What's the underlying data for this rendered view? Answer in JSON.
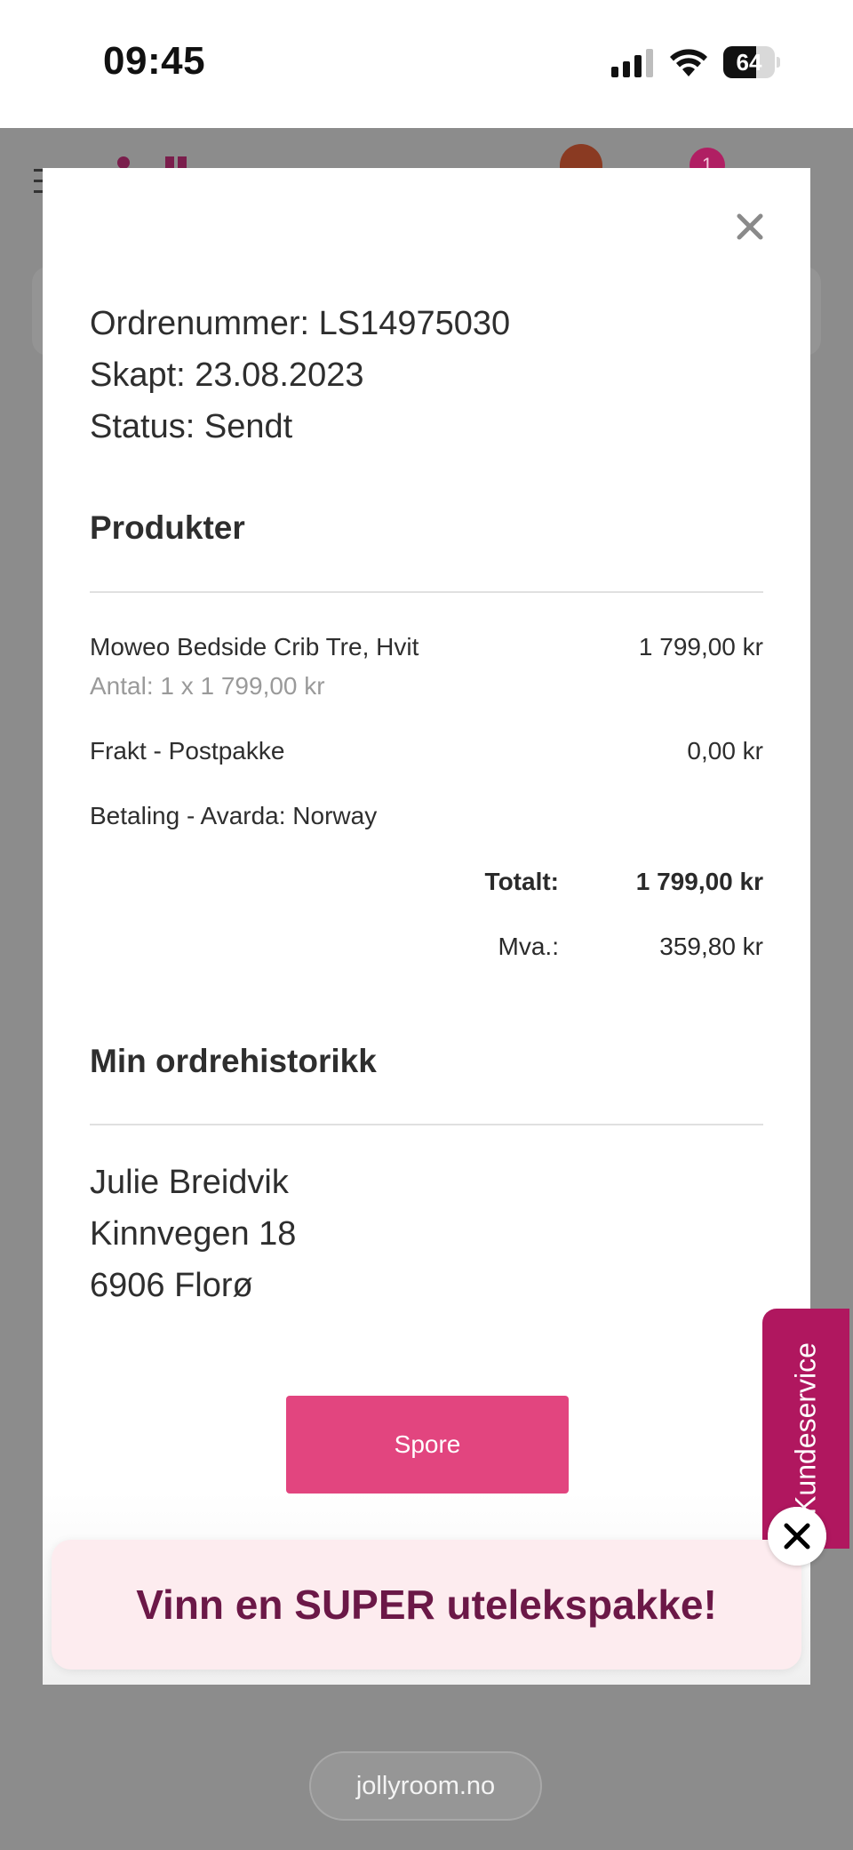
{
  "status_bar": {
    "time": "09:45",
    "battery_level": "64",
    "icons": [
      "signal-icon",
      "wifi-icon",
      "battery-icon"
    ]
  },
  "background": {
    "cart_count": "1",
    "domain": "jollyroom.no"
  },
  "order": {
    "number_line": "Ordrenummer: LS14975030",
    "created_line": "Skapt: 23.08.2023",
    "status_line": "Status: Sendt"
  },
  "products": {
    "title": "Produkter",
    "item": {
      "name": "Moweo Bedside Crib Tre, Hvit",
      "price": "1 799,00 kr",
      "quantity": "Antal: 1 x 1 799,00 kr"
    },
    "shipping": {
      "label": "Frakt - Postpakke",
      "price": "0,00 kr"
    },
    "payment": {
      "label": "Betaling - Avarda: Norway"
    },
    "total": {
      "label": "Totalt:",
      "value": "1 799,00 kr"
    },
    "vat": {
      "label": "Mva.:",
      "value": "359,80 kr"
    }
  },
  "history": {
    "title": "Min ordrehistorikk",
    "address": {
      "name": "Julie Breidvik",
      "street": "Kinnvegen 18",
      "city": "6906 Florø"
    }
  },
  "track_button_label": "Spore",
  "promo": {
    "text": "Vinn en SUPER utelekspakke!"
  },
  "side_tab": {
    "label": "Kundeservice"
  },
  "colors": {
    "accent_pink": "#e2457f",
    "brand_magenta": "#b0175f",
    "promo_text": "#6b1847",
    "promo_bg": "#fdecef"
  }
}
